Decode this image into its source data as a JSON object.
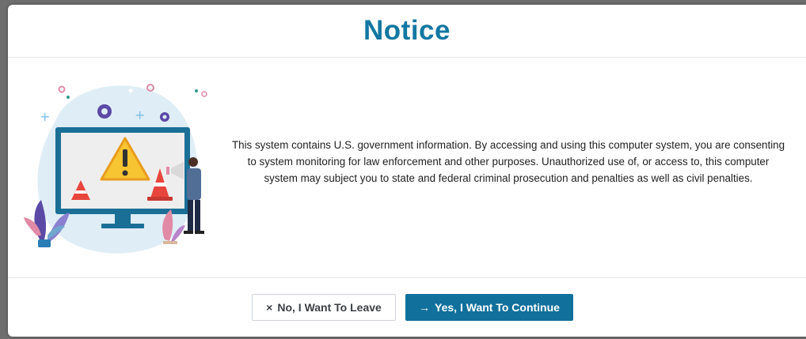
{
  "modal": {
    "title": "Notice",
    "body_text": "This system contains U.S. government information. By accessing and using this computer system, you are consenting to system monitoring for law enforcement and other purposes. Unauthorized use of, or access to, this computer system may subject you to state and federal criminal prosecution and penalties as well as civil penalties.",
    "illustration": "warning-monitor-illustration"
  },
  "buttons": {
    "leave_icon": "×",
    "leave_label": "No, I Want To Leave",
    "continue_icon": "→",
    "continue_label": "Yes, I Want To Continue"
  },
  "colors": {
    "title": "#1277a3",
    "primary_button": "#11709c",
    "warning": "#f7c531",
    "cone": "#e8453c"
  }
}
